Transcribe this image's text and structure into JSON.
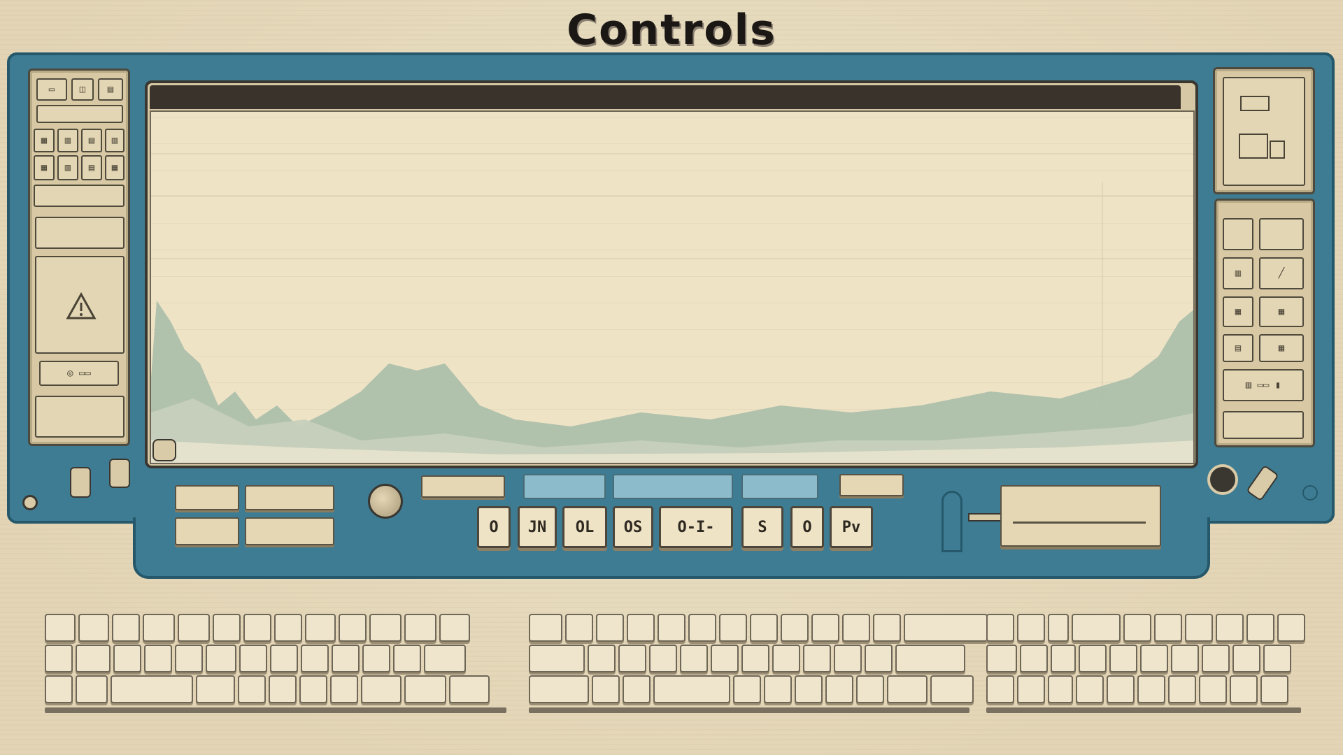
{
  "page": {
    "title": "Controls"
  },
  "colors": {
    "console_body": "#3e7c93",
    "console_border": "#26586b",
    "paper": "#e8dcc0",
    "screen": "#efe3c6",
    "screen_bar": "#3a332b",
    "accent_blue": "#8cbccb"
  },
  "control_strip": {
    "key_buttons": [
      "O",
      "JN",
      "OL",
      "OS",
      "O-I-",
      "S",
      "O",
      "Pv"
    ]
  },
  "icons": {
    "left_panel": [
      "window-icon",
      "grid-icon",
      "warning-icon",
      "gauge-icon"
    ],
    "right_panel": [
      "monitor-icon",
      "grid-icon"
    ],
    "console": [
      "dial-knob-icon",
      "lever-icon",
      "plug-icon",
      "screw-icon"
    ]
  }
}
